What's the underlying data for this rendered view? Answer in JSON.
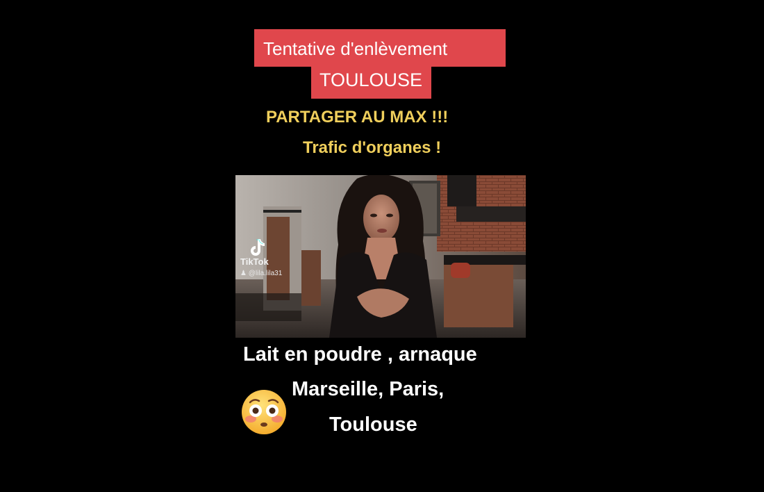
{
  "overlay": {
    "headline_line1": "Tentative d'enlèvement",
    "headline_line2": "TOULOUSE",
    "share_text": "PARTAGER AU MAX !!!",
    "organs_text": "Trafic d'organes !"
  },
  "video": {
    "watermark_brand": "TikTok",
    "watermark_handle": "@lila.lila31"
  },
  "caption": {
    "line1": "Lait en poudre , arnaque",
    "line2": "Marseille, Paris,",
    "line3": "Toulouse"
  },
  "emoji": {
    "icon": "flushed-face-icon"
  },
  "colors": {
    "background": "#000000",
    "headline_box": "#e0474c",
    "highlight_text": "#f0cf5c",
    "caption_text": "#ffffff"
  }
}
